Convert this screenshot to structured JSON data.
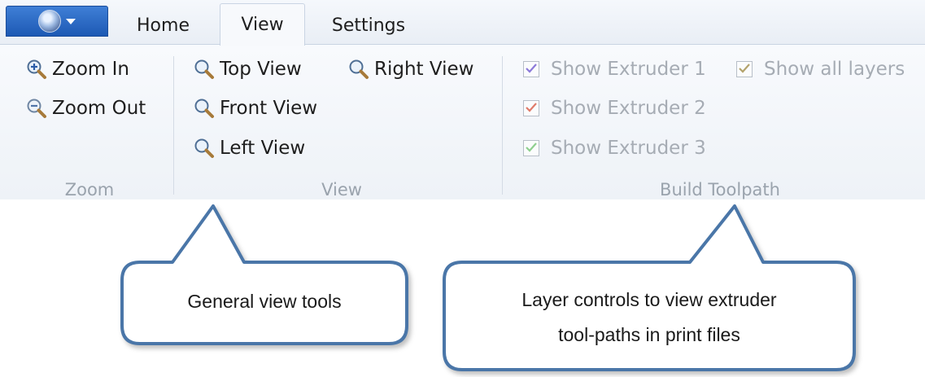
{
  "app_menu": {
    "icon": "globe-icon"
  },
  "tabs": [
    {
      "label": "Home"
    },
    {
      "label": "View",
      "active": true
    },
    {
      "label": "Settings"
    }
  ],
  "groups": {
    "zoom": {
      "label": "Zoom",
      "buttons": [
        {
          "label": "Zoom In",
          "icon": "zoom-in-icon"
        },
        {
          "label": "Zoom Out",
          "icon": "zoom-out-icon"
        }
      ]
    },
    "view": {
      "label": "View",
      "buttons": [
        {
          "label": "Top View",
          "icon": "magnifier-icon"
        },
        {
          "label": "Right View",
          "icon": "magnifier-icon"
        },
        {
          "label": "Front View",
          "icon": "magnifier-icon"
        },
        {
          "label": "Left View",
          "icon": "magnifier-icon"
        }
      ]
    },
    "build_toolpath": {
      "label": "Build Toolpath",
      "checkboxes": [
        {
          "label": "Show Extruder 1",
          "checked": true,
          "check_color": "#8c7ad9",
          "enabled": false
        },
        {
          "label": "Show all layers",
          "checked": true,
          "check_color": "#b3a36c",
          "enabled": false
        },
        {
          "label": "Show Extruder 2",
          "checked": true,
          "check_color": "#e07b6a",
          "enabled": false
        },
        {
          "label": "Show Extruder 3",
          "checked": true,
          "check_color": "#8fcf8f",
          "enabled": false
        }
      ]
    }
  },
  "callouts": [
    {
      "text": "General view tools"
    },
    {
      "line1": "Layer controls to view extruder",
      "line2": "tool-paths in print files"
    }
  ],
  "colors": {
    "callout_border": "#4a76a8",
    "app_menu_blue": "#1d59b4"
  }
}
